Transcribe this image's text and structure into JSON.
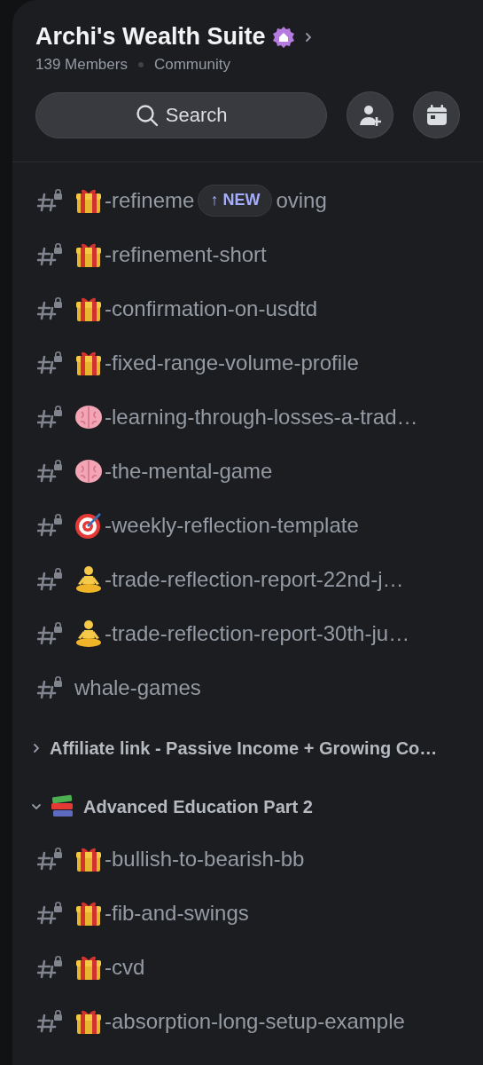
{
  "server": {
    "name": "Archi's Wealth Suite",
    "members": "139 Members",
    "type": "Community"
  },
  "search": {
    "label": "Search"
  },
  "new_badge": {
    "label": "↑ NEW"
  },
  "channels": [
    {
      "kind": "gift",
      "parts": [
        "-refineme",
        "oving"
      ],
      "new_badge": true
    },
    {
      "kind": "gift",
      "parts": [
        "-refinement-short"
      ]
    },
    {
      "kind": "gift",
      "parts": [
        "-confirmation-on-usdtd"
      ]
    },
    {
      "kind": "gift",
      "parts": [
        "-fixed-range-volume-profile"
      ]
    },
    {
      "kind": "brain",
      "parts": [
        "-learning-through-losses-a-trad…"
      ]
    },
    {
      "kind": "brain",
      "parts": [
        "-the-mental-game"
      ]
    },
    {
      "kind": "target",
      "parts": [
        "-weekly-reflection-template"
      ]
    },
    {
      "kind": "meditate",
      "parts": [
        "-trade-reflection-report-22nd-j…"
      ]
    },
    {
      "kind": "meditate",
      "parts": [
        "-trade-reflection-report-30th-ju…"
      ]
    },
    {
      "kind": "plain",
      "parts": [
        "whale-games"
      ]
    }
  ],
  "categories": [
    {
      "name": "Affiliate link - Passive Income + Growing Co…",
      "kind": "plain",
      "expanded": false
    },
    {
      "name": "Advanced Education Part 2",
      "kind": "books",
      "expanded": true,
      "channels": [
        {
          "kind": "gift",
          "parts": [
            "-bullish-to-bearish-bb"
          ]
        },
        {
          "kind": "gift",
          "parts": [
            "-fib-and-swings"
          ]
        },
        {
          "kind": "gift",
          "parts": [
            "-cvd"
          ]
        },
        {
          "kind": "gift",
          "parts": [
            "-absorption-long-setup-example"
          ]
        }
      ]
    }
  ]
}
